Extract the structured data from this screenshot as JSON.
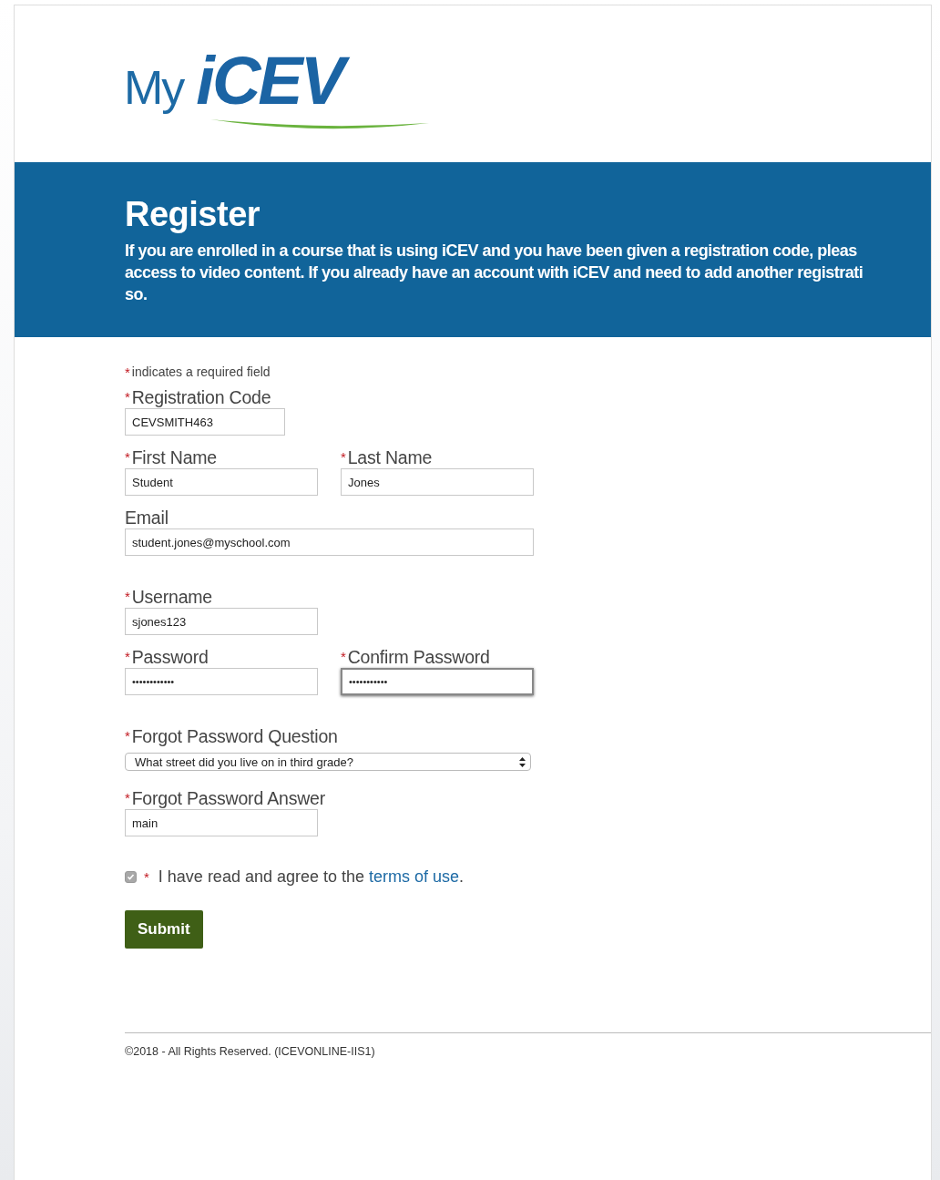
{
  "logo": {
    "prefix": "My",
    "name": "iCEV"
  },
  "banner": {
    "title": "Register",
    "lines": [
      "If you are enrolled in a course that is using iCEV and you have been given a registration code, pleas",
      "access to video content. If you already have an account with iCEV and need to add another registrati",
      "so."
    ]
  },
  "form": {
    "required_note": {
      "mark": "*",
      "text": "indicates a required field"
    },
    "sections": [
      [
        [
          {
            "label": "Registration Code",
            "required": true,
            "kind": "code",
            "value": "CEVSMITH463",
            "focused": false
          }
        ],
        [
          {
            "label": "First Name",
            "required": true,
            "kind": "text",
            "value": "Student",
            "focused": false
          },
          {
            "label": "Last Name",
            "required": true,
            "kind": "text",
            "value": "Jones",
            "focused": false
          }
        ],
        [
          {
            "label": "Email",
            "required": false,
            "kind": "email",
            "value": "student.jones@myschool.com",
            "focused": false
          }
        ]
      ],
      [
        [
          {
            "label": "Username",
            "required": true,
            "kind": "text",
            "value": "sjones123",
            "focused": false
          }
        ],
        [
          {
            "label": "Password",
            "required": true,
            "kind": "password",
            "value": "••••••••••••",
            "focused": false
          },
          {
            "label": "Confirm Password",
            "required": true,
            "kind": "password",
            "value": "•••••••••••",
            "focused": true
          }
        ]
      ],
      [
        [
          {
            "label": "Forgot Password Question",
            "required": true,
            "kind": "select",
            "value": "What street did you live on in third grade?",
            "focused": false
          }
        ],
        [
          {
            "label": "Forgot Password Answer",
            "required": true,
            "kind": "text",
            "value": "main",
            "focused": false
          }
        ]
      ]
    ],
    "agreement": {
      "checked": true,
      "required": true,
      "text": "I have read and agree to the",
      "link": "terms of use",
      "end": "."
    },
    "submit": "Submit"
  },
  "footer": "©2018 - All Rights Reserved. (ICEVONLINE-IIS1)"
}
